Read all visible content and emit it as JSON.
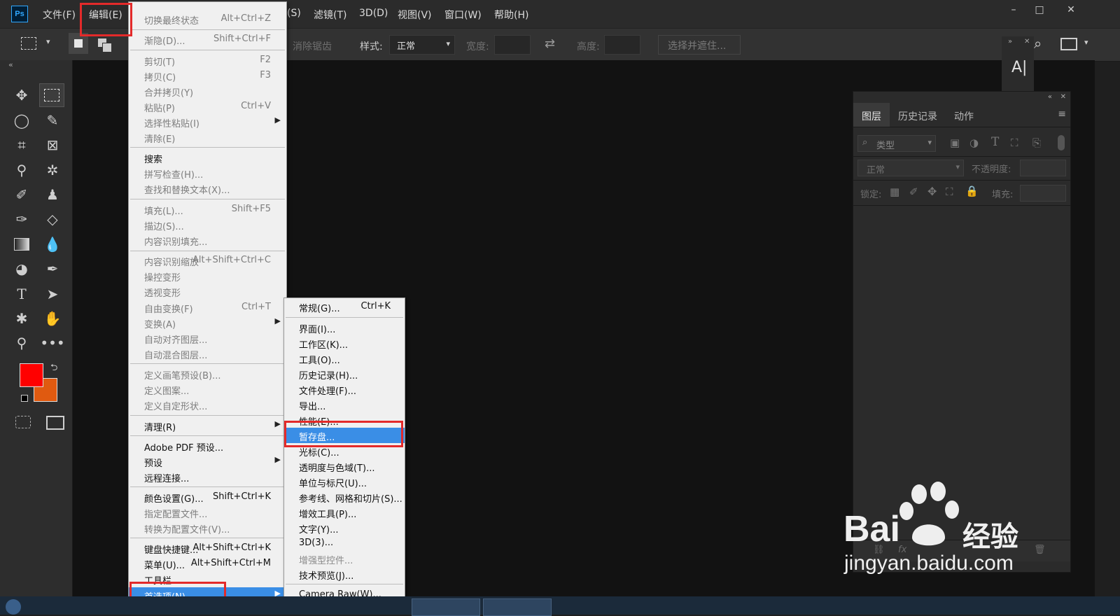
{
  "app": {
    "logo": "Ps"
  },
  "menubar": {
    "items": [
      "文件(F)",
      "编辑(E)",
      "(S)",
      "滤镜(T)",
      "3D(D)",
      "视图(V)",
      "窗口(W)",
      "帮助(H)"
    ]
  },
  "window_controls": {
    "minimize": "–",
    "maximize": "□",
    "close": "✕"
  },
  "options_bar": {
    "antialias": "消除锯齿",
    "style_label": "样式:",
    "style_value": "正常",
    "width_label": "宽度:",
    "height_label": "高度:",
    "select_mask_button": "选择并遮住..."
  },
  "edit_menu": {
    "items": [
      {
        "label": "切换最终状态",
        "shortcut": "Alt+Ctrl+Z",
        "disabled": true
      },
      {
        "label": "渐隐(D)...",
        "shortcut": "Shift+Ctrl+F",
        "disabled": true
      },
      {
        "label": "剪切(T)",
        "shortcut": "F2",
        "disabled": true
      },
      {
        "label": "拷贝(C)",
        "shortcut": "F3",
        "disabled": true
      },
      {
        "label": "合并拷贝(Y)",
        "shortcut": "",
        "disabled": true
      },
      {
        "label": "粘贴(P)",
        "shortcut": "Ctrl+V",
        "disabled": true
      },
      {
        "label": "选择性粘贴(I)",
        "shortcut": "",
        "disabled": true,
        "submenu": true
      },
      {
        "label": "清除(E)",
        "shortcut": "",
        "disabled": true
      },
      {
        "label": "搜索",
        "shortcut": "",
        "disabled": false
      },
      {
        "label": "拼写检查(H)...",
        "shortcut": "",
        "disabled": true
      },
      {
        "label": "查找和替换文本(X)...",
        "shortcut": "",
        "disabled": true
      },
      {
        "label": "填充(L)...",
        "shortcut": "Shift+F5",
        "disabled": true
      },
      {
        "label": "描边(S)...",
        "shortcut": "",
        "disabled": true
      },
      {
        "label": "内容识别填充...",
        "shortcut": "",
        "disabled": true
      },
      {
        "label": "内容识别缩放",
        "shortcut": "Alt+Shift+Ctrl+C",
        "disabled": true
      },
      {
        "label": "操控变形",
        "shortcut": "",
        "disabled": true
      },
      {
        "label": "透视变形",
        "shortcut": "",
        "disabled": true
      },
      {
        "label": "自由变换(F)",
        "shortcut": "Ctrl+T",
        "disabled": true
      },
      {
        "label": "变换(A)",
        "shortcut": "",
        "disabled": true,
        "submenu": true
      },
      {
        "label": "自动对齐图层...",
        "shortcut": "",
        "disabled": true
      },
      {
        "label": "自动混合图层...",
        "shortcut": "",
        "disabled": true
      },
      {
        "label": "定义画笔预设(B)...",
        "shortcut": "",
        "disabled": true
      },
      {
        "label": "定义图案...",
        "shortcut": "",
        "disabled": true
      },
      {
        "label": "定义自定形状...",
        "shortcut": "",
        "disabled": true
      },
      {
        "label": "清理(R)",
        "shortcut": "",
        "disabled": false,
        "submenu": true
      },
      {
        "label": "Adobe PDF 预设...",
        "shortcut": "",
        "disabled": false
      },
      {
        "label": "预设",
        "shortcut": "",
        "disabled": false,
        "submenu": true
      },
      {
        "label": "远程连接...",
        "shortcut": "",
        "disabled": false
      },
      {
        "label": "颜色设置(G)...",
        "shortcut": "Shift+Ctrl+K",
        "disabled": false
      },
      {
        "label": "指定配置文件...",
        "shortcut": "",
        "disabled": true
      },
      {
        "label": "转换为配置文件(V)...",
        "shortcut": "",
        "disabled": true
      },
      {
        "label": "键盘快捷键...",
        "shortcut": "Alt+Shift+Ctrl+K",
        "disabled": false
      },
      {
        "label": "菜单(U)...",
        "shortcut": "Alt+Shift+Ctrl+M",
        "disabled": false
      },
      {
        "label": "工具栏...",
        "shortcut": "",
        "disabled": false
      },
      {
        "label": "首选项(N)",
        "shortcut": "",
        "disabled": false,
        "submenu": true,
        "highlighted": true
      }
    ]
  },
  "prefs_submenu": {
    "items": [
      {
        "label": "常规(G)...",
        "shortcut": "Ctrl+K"
      },
      {
        "label": "界面(I)..."
      },
      {
        "label": "工作区(K)..."
      },
      {
        "label": "工具(O)..."
      },
      {
        "label": "历史记录(H)..."
      },
      {
        "label": "文件处理(F)..."
      },
      {
        "label": "导出..."
      },
      {
        "label": "性能(E)..."
      },
      {
        "label": "暂存盘...",
        "highlighted": true
      },
      {
        "label": "光标(C)..."
      },
      {
        "label": "透明度与色域(T)..."
      },
      {
        "label": "单位与标尺(U)..."
      },
      {
        "label": "参考线、网格和切片(S)..."
      },
      {
        "label": "增效工具(P)..."
      },
      {
        "label": "文字(Y)..."
      },
      {
        "label": "3D(3)..."
      },
      {
        "label": "增强型控件...",
        "disabled": true
      },
      {
        "label": "技术预览(J)..."
      },
      {
        "label": "Camera Raw(W)..."
      }
    ]
  },
  "layers_panel": {
    "tabs": [
      "图层",
      "历史记录",
      "动作"
    ],
    "filter_placeholder": "类型",
    "blend_mode": "正常",
    "opacity_label": "不透明度:",
    "lock_label": "锁定:",
    "fill_label": "填充:"
  },
  "colors": {
    "foreground": "#ff0000",
    "background": "#e05a10",
    "highlight": "#3a8ee6",
    "annotation": "#e32a2a"
  },
  "watermark": {
    "brand": "Bai",
    "brand_cn": "经验",
    "url": "jingyan.baidu.com"
  }
}
